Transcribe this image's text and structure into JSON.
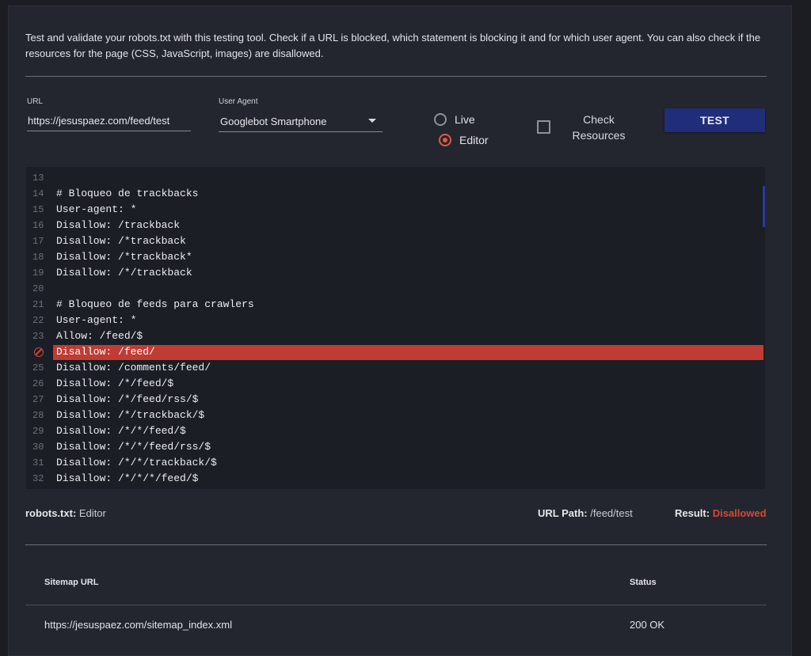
{
  "intro": {
    "text": "Test and validate your robots.txt with this testing tool. Check if a URL is blocked, which statement is blocking it and for which user agent. You can also check if the resources for the page (CSS, JavaScript, images) are disallowed."
  },
  "form": {
    "url_label": "URL",
    "url_value": "https://jesuspaez.com/feed/test",
    "ua_label": "User Agent",
    "ua_value": "Googlebot Smartphone",
    "radio_live": "Live",
    "radio_editor": "Editor",
    "radio_selected": "Editor",
    "check_resources_label": "Check Resources",
    "check_resources_checked": false,
    "test_button": "TEST"
  },
  "editor": {
    "lines": [
      {
        "num": "13",
        "text": ""
      },
      {
        "num": "14",
        "text": "# Bloqueo de trackbacks"
      },
      {
        "num": "15",
        "text": "User-agent: *"
      },
      {
        "num": "16",
        "text": "Disallow: /trackback"
      },
      {
        "num": "17",
        "text": "Disallow: /*trackback"
      },
      {
        "num": "18",
        "text": "Disallow: /*trackback*"
      },
      {
        "num": "19",
        "text": "Disallow: /*/trackback"
      },
      {
        "num": "20",
        "text": ""
      },
      {
        "num": "21",
        "text": "# Bloqueo de feeds para crawlers"
      },
      {
        "num": "22",
        "text": "User-agent: *"
      },
      {
        "num": "23",
        "text": "Allow: /feed/$"
      },
      {
        "num": "",
        "text": "Disallow: /feed/",
        "blocked": true
      },
      {
        "num": "25",
        "text": "Disallow: /comments/feed/"
      },
      {
        "num": "26",
        "text": "Disallow: /*/feed/$"
      },
      {
        "num": "27",
        "text": "Disallow: /*/feed/rss/$"
      },
      {
        "num": "28",
        "text": "Disallow: /*/trackback/$"
      },
      {
        "num": "29",
        "text": "Disallow: /*/*/feed/$"
      },
      {
        "num": "30",
        "text": "Disallow: /*/*/feed/rss/$"
      },
      {
        "num": "31",
        "text": "Disallow: /*/*/trackback/$"
      },
      {
        "num": "32",
        "text": "Disallow: /*/*/*/feed/$"
      }
    ],
    "highlight_color": "#bf3c34"
  },
  "status": {
    "robots_label": "robots.txt:",
    "robots_value": "Editor",
    "url_path_label": "URL Path:",
    "url_path_value": "/feed/test",
    "result_label": "Result:",
    "result_value": "Disallowed",
    "result_color": "#d84735"
  },
  "sitemap_table": {
    "columns": [
      "Sitemap URL",
      "Status"
    ],
    "rows": [
      {
        "url": "https://jesuspaez.com/sitemap_index.xml",
        "status": "200 OK"
      }
    ]
  }
}
